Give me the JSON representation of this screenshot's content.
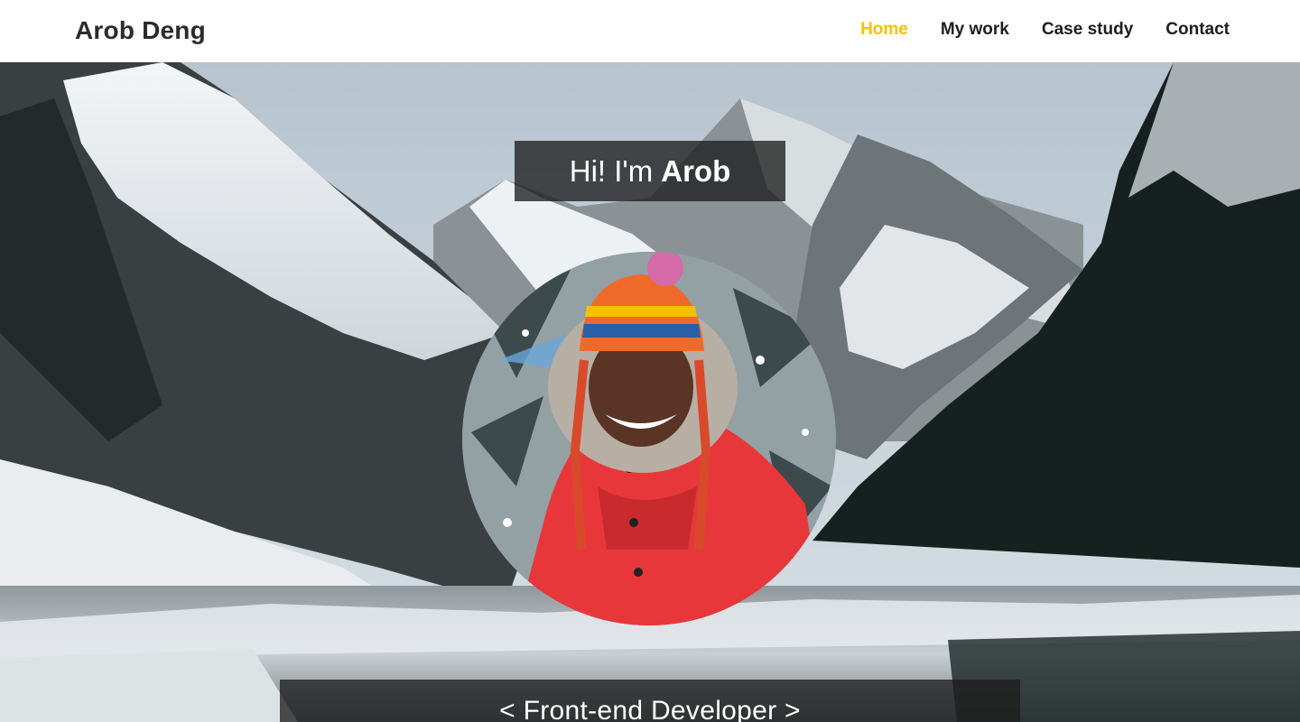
{
  "header": {
    "brand": "Arob Deng",
    "nav": [
      {
        "label": "Home",
        "active": true
      },
      {
        "label": "My work",
        "active": false
      },
      {
        "label": "Case study",
        "active": false
      },
      {
        "label": "Contact",
        "active": false
      }
    ]
  },
  "hero": {
    "greeting_prefix": "Hi! I'm",
    "greeting_name": "Arob",
    "role": "< Front-end Developer >",
    "background_image": "snowy-mountain-lake-photo",
    "portrait_image": "profile-photo"
  },
  "colors": {
    "accent": "#f2c200",
    "nav_text": "#1e1e1e",
    "overlay": "#1e1e1e"
  }
}
